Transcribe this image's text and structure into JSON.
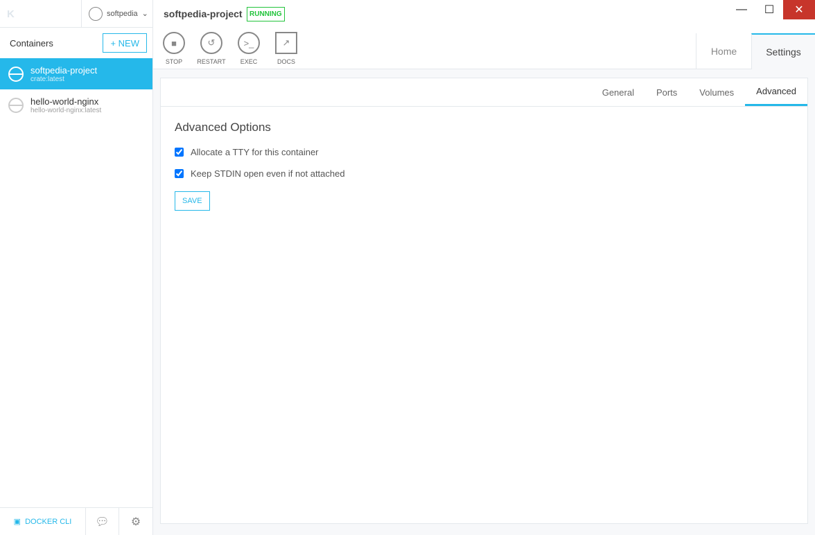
{
  "sidebar": {
    "logo": "K",
    "user": "softpedia",
    "heading": "Containers",
    "new_label": "+ NEW",
    "containers": [
      {
        "name": "softpedia-project",
        "image": "crate:latest"
      },
      {
        "name": "hello-world-nginx",
        "image": "hello-world-nginx:latest"
      }
    ],
    "docker_cli": "DOCKER CLI"
  },
  "header": {
    "title": "softpedia-project",
    "status": "RUNNING",
    "actions": [
      "STOP",
      "RESTART",
      "EXEC",
      "DOCS"
    ],
    "tabs": [
      "Home",
      "Settings"
    ]
  },
  "settings": {
    "tabs": [
      "General",
      "Ports",
      "Volumes",
      "Advanced"
    ],
    "heading": "Advanced Options",
    "options": [
      "Allocate a TTY for this container",
      "Keep STDIN open even if not attached"
    ],
    "save": "SAVE"
  }
}
